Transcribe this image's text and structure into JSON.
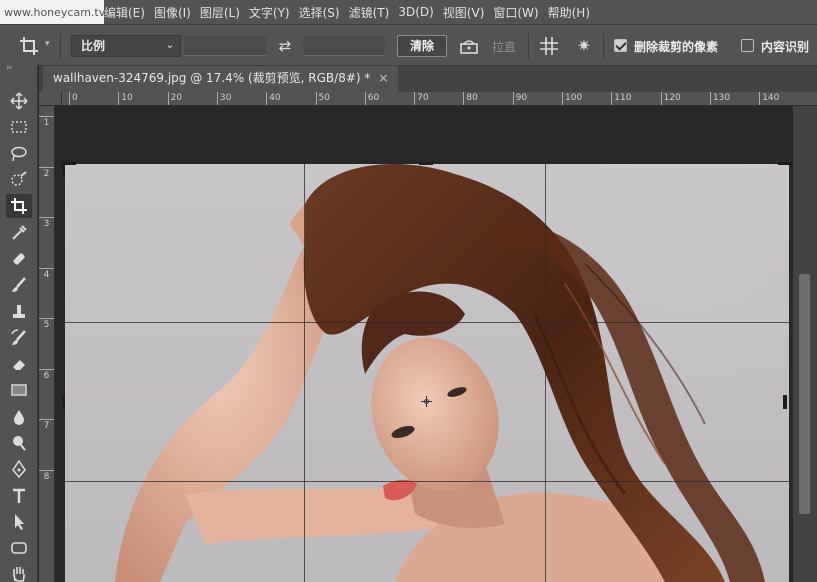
{
  "watermark": "www.honeycam.tv",
  "menu": [
    "编辑(E)",
    "图像(I)",
    "图层(L)",
    "文字(Y)",
    "选择(S)",
    "滤镜(T)",
    "3D(D)",
    "视图(V)",
    "窗口(W)",
    "帮助(H)"
  ],
  "options": {
    "ratio": "比例",
    "clear": "清除",
    "straighten": "拉直",
    "delete_cropped": "删除裁剪的像素",
    "content_aware": "内容识别",
    "delete_cropped_checked": true,
    "content_aware_checked": false
  },
  "tools": [
    "move-tool",
    "marquee-tool",
    "lasso-tool",
    "quick-select-tool",
    "crop-tool",
    "eyedropper-tool",
    "healing-brush-tool",
    "brush-tool",
    "clone-stamp-tool",
    "history-brush-tool",
    "eraser-tool",
    "gradient-tool",
    "blur-tool",
    "dodge-tool",
    "pen-tool",
    "type-tool",
    "path-select-tool",
    "shape-tool",
    "hand-tool"
  ],
  "document": {
    "tab_title": "wallhaven-324769.jpg @ 17.4% (裁剪预览, RGB/8#) *",
    "close": "×"
  },
  "ruler_h": [
    "0",
    "10",
    "20",
    "30",
    "40",
    "50",
    "60",
    "70",
    "80",
    "90",
    "100",
    "110",
    "120",
    "130",
    "140"
  ],
  "ruler_v": [
    "1",
    "2",
    "3",
    "4",
    "5",
    "6",
    "7",
    "8"
  ],
  "colors": {
    "ui_bg": "#535353",
    "canvas_bg": "#282828",
    "hair": "#5a2e1c",
    "skin": "#e6b9a6"
  }
}
